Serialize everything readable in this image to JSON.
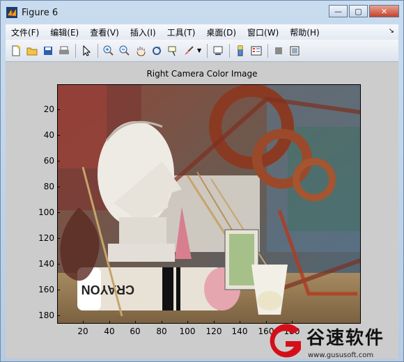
{
  "window": {
    "title": "Figure 6",
    "controls": {
      "minimize": "—",
      "maximize": "▢",
      "close": "✕"
    }
  },
  "menubar": {
    "items": [
      "文件(F)",
      "编辑(E)",
      "查看(V)",
      "插入(I)",
      "工具(T)",
      "桌面(D)",
      "窗口(W)",
      "帮助(H)"
    ],
    "overflow": "↘"
  },
  "toolbar": {
    "buttons": [
      "new-figure",
      "open-file",
      "save",
      "print",
      "edit-plot-arrow",
      "zoom-in",
      "zoom-out",
      "pan-hand",
      "rotate-3d",
      "data-cursor",
      "brush",
      "link-plot",
      "insert-colorbar",
      "insert-legend",
      "hide-plot-tools",
      "show-plot-tools"
    ]
  },
  "figure": {
    "title": "Right Camera Color Image",
    "y_ticks": [
      "20",
      "40",
      "60",
      "80",
      "100",
      "120",
      "140",
      "160",
      "180"
    ],
    "x_ticks": [
      "20",
      "40",
      "60",
      "80",
      "100",
      "120",
      "140",
      "160",
      "180"
    ],
    "image_description": "Stereo right-camera photo of a plaster head, crayon, pink cone and rust-coloured rings"
  },
  "watermark": {
    "text": "谷速软件",
    "url": "www.gususoft.com",
    "color": "#d40f1a"
  }
}
